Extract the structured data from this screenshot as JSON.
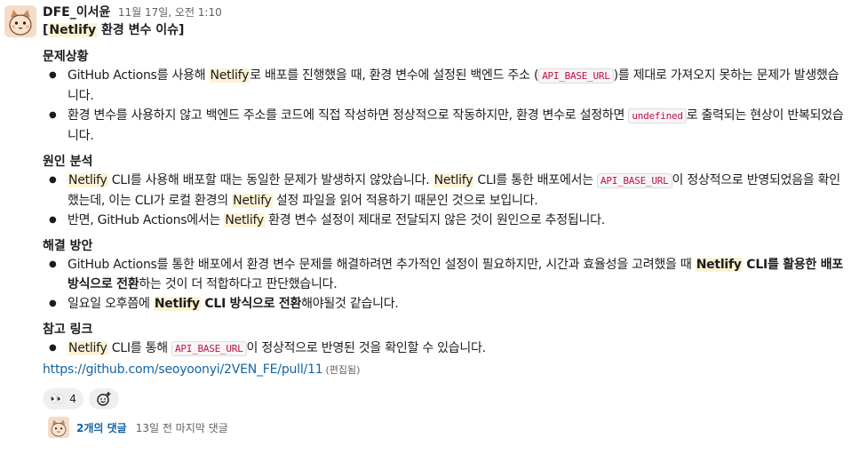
{
  "message": {
    "sender": "DFE_이서윤",
    "timestamp": "11월 17일, 오전 1:10",
    "title_pre": "[",
    "title_hl": "Netlify",
    "title_post": " 환경 변수 이슈]",
    "s1": {
      "heading": "문제상황",
      "b1": {
        "t1": "GitHub Actions를 사용해 ",
        "hl1": "Netlify",
        "t2": "로 배포를 진행했을 때, 환경 변수에 설정된 백엔드 주소 (",
        "code1": "API_BASE_URL",
        "t3": ")를 제대로 가져오지 못하는 문제가 발생했습니다."
      },
      "b2": {
        "t1": "환경 변수를 사용하지 않고 백엔드 주소를 코드에 직접 작성하면 정상적으로 작동하지만, 환경 변수로 설정하면 ",
        "code1": "undefined",
        "t2": "로 출력되는 현상이 반복되었습니다."
      }
    },
    "s2": {
      "heading": "원인 분석",
      "b1": {
        "hl1": "Netlify",
        "t1": " CLI를 사용해 배포할 때는 동일한 문제가 발생하지 않았습니다. ",
        "hl2": "Netlify",
        "t2": " CLI를 통한 배포에서는 ",
        "code1": "API_BASE_URL",
        "t3": "이 정상적으로 반영되었음을 확인했는데, 이는 CLI가 로컬 환경의 ",
        "hl3": "Netlify",
        "t4": " 설정 파일을 읽어 적용하기 때문인 것으로 보입니다."
      },
      "b2": {
        "t1": "반면, GitHub Actions에서는 ",
        "hl1": "Netlify",
        "t2": " 환경 변수 설정이 제대로 전달되지 않은 것이 원인으로 추정됩니다."
      }
    },
    "s3": {
      "heading": "해결 방안",
      "b1": {
        "t1": "GitHub Actions를 통한 배포에서 환경 변수 문제를 해결하려면 추가적인 설정이 필요하지만, 시간과 효율성을 고려했을 때 ",
        "hl1": "Netlify",
        "bold1": " CLI를 활용한 배포 방식으로 전환",
        "t2": "하는 것이 더 적합하다고 판단했습니다."
      },
      "b2": {
        "t1": "일요일 오후쯤에 ",
        "hl1": "Netlify",
        "bold1": " CLI 방식으로 전환",
        "t2": "해야될것 같습니다."
      }
    },
    "s4": {
      "heading": "참고 링크",
      "b1": {
        "hl1": "Netlify",
        "t1": " CLI를 통해 ",
        "code1": "API_BASE_URL",
        "t2": "이 정상적으로 반영된 것을 확인할 수 있습니다."
      }
    },
    "link": "https://github.com/seoyoonyi/2VEN_FE/pull/11",
    "edited": "(편집됨)"
  },
  "reactions": [
    {
      "emoji": "👀",
      "emoji_name": "eyes-icon",
      "count": "4"
    }
  ],
  "add_reaction_icon": "add-emoji-icon",
  "thread": {
    "reply_count": "2개의 댓글",
    "last_reply": "13일 전 마지막 댓글"
  },
  "colors": {
    "highlight": "#fdf3d4",
    "link": "#1264a3",
    "code_text": "#c01343",
    "avatar_bg": "#f3dcc8"
  }
}
